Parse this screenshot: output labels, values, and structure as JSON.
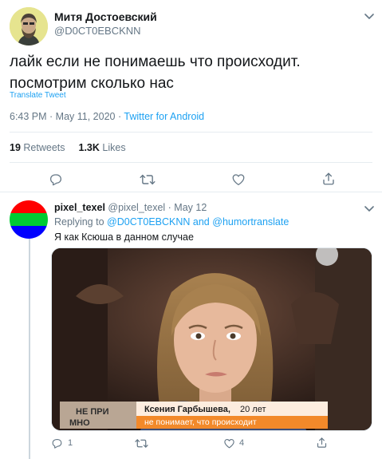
{
  "tweet": {
    "author_name": "Митя Достоевский",
    "author_handle": "@D0CT0EBCKNN",
    "text": "лайк если не понимаешь что происходит. посмотрим сколько нас",
    "translate_label": "Translate Tweet",
    "time": "6:43 PM",
    "date": "May 11, 2020",
    "separator": " · ",
    "source": "Twitter for Android",
    "retweets_count": "19",
    "retweets_label": "Retweets",
    "likes_count": "1.3K",
    "likes_label": "Likes"
  },
  "reply": {
    "name": "pixel_texel",
    "handle": "@pixel_texel",
    "date": "May 12",
    "separator": " · ",
    "replying_prefix": "Replying to",
    "mention_1": "@D0CT0EBCKNN",
    "and_word": "and",
    "mention_2": "@humortranslate",
    "text": "Я как Ксюша в данном случае",
    "media": {
      "caption_name": "Ксения Гарбышева,",
      "caption_age": "20 лет",
      "caption_sub": "не понимает, что происходит",
      "logo_text_1": "НЕ ПРИ",
      "logo_text_2": "МНО"
    },
    "reply_count": "1",
    "like_count": "4"
  },
  "colors": {
    "accent": "#1da1f2",
    "secondary_text": "#657786",
    "border": "#e6ecf0",
    "caption_orange": "#f2892a"
  },
  "icons": {
    "caret": "chevron-down-icon",
    "reply": "reply-icon",
    "retweet": "retweet-icon",
    "like": "heart-icon",
    "share": "share-icon"
  }
}
